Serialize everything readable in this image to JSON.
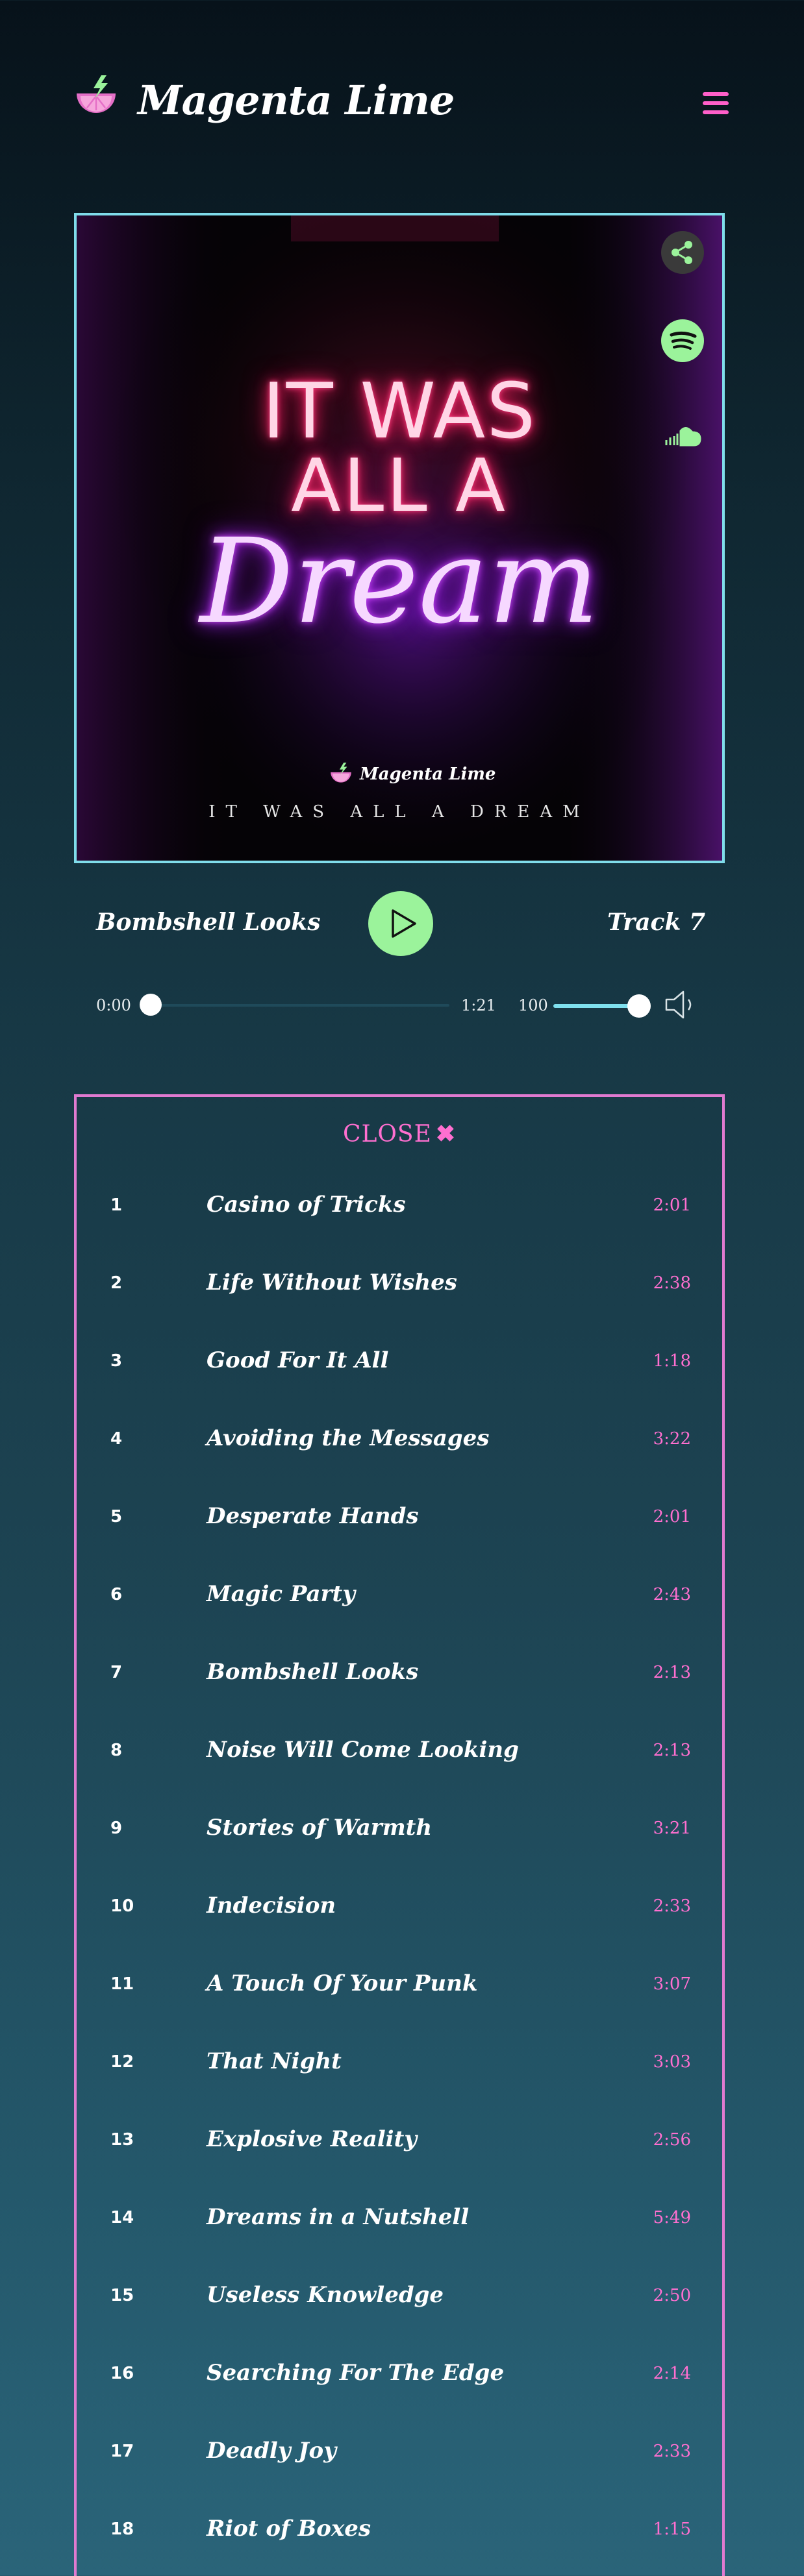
{
  "header": {
    "brand": "Magenta Lime",
    "logo_icon": "lime-slice-lightning-icon",
    "menu_icon": "hamburger-menu-icon",
    "accent_color": "#ff5fc9"
  },
  "album": {
    "neon_line1": "IT WAS",
    "neon_line2": "ALL A",
    "neon_line3": "Dream",
    "label_brand": "Magenta Lime",
    "caption": "IT WAS ALL A DREAM",
    "border_color": "#7fdcea",
    "side_icons": [
      "share-icon",
      "spotify-icon",
      "soundcloud-icon"
    ]
  },
  "player": {
    "song_title": "Bombshell Looks",
    "track_label": "Track 7",
    "time_current": "0:00",
    "time_total": "1:21",
    "progress": 0,
    "volume": "100",
    "volume_level": 1.0,
    "play_icon": "play-icon",
    "volume_icon": "speaker-icon",
    "play_color": "#9bf39b"
  },
  "playlist": {
    "close_label": "CLOSE",
    "close_icon": "✖",
    "border_color": "#e07ad0",
    "tracks": [
      {
        "num": "1",
        "title": "Casino of Tricks",
        "duration": "2:01"
      },
      {
        "num": "2",
        "title": "Life Without Wishes",
        "duration": "2:38"
      },
      {
        "num": "3",
        "title": "Good For It All",
        "duration": "1:18"
      },
      {
        "num": "4",
        "title": "Avoiding the Messages",
        "duration": "3:22"
      },
      {
        "num": "5",
        "title": "Desperate Hands",
        "duration": "2:01"
      },
      {
        "num": "6",
        "title": "Magic Party",
        "duration": "2:43"
      },
      {
        "num": "7",
        "title": "Bombshell Looks",
        "duration": "2:13"
      },
      {
        "num": "8",
        "title": "Noise Will Come Looking",
        "duration": "2:13"
      },
      {
        "num": "9",
        "title": "Stories of Warmth",
        "duration": "3:21"
      },
      {
        "num": "10",
        "title": "Indecision",
        "duration": "2:33"
      },
      {
        "num": "11",
        "title": "A Touch Of Your Punk",
        "duration": "3:07"
      },
      {
        "num": "12",
        "title": "That Night",
        "duration": "3:03"
      },
      {
        "num": "13",
        "title": "Explosive Reality",
        "duration": "2:56"
      },
      {
        "num": "14",
        "title": "Dreams in a Nutshell",
        "duration": "5:49"
      },
      {
        "num": "15",
        "title": "Useless Knowledge",
        "duration": "2:50"
      },
      {
        "num": "16",
        "title": "Searching For The Edge",
        "duration": "2:14"
      },
      {
        "num": "17",
        "title": "Deadly Joy",
        "duration": "2:33"
      },
      {
        "num": "18",
        "title": "Riot of Boxes",
        "duration": "1:15"
      }
    ]
  }
}
